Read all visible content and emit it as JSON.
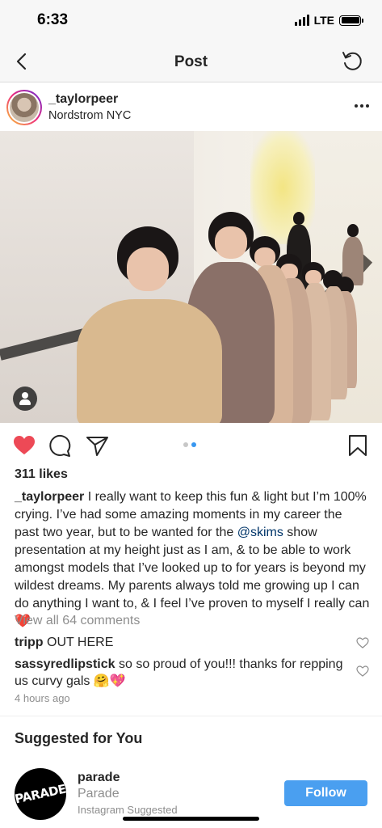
{
  "status_bar": {
    "time": "6:33",
    "network": "LTE",
    "icons": [
      "signal-icon",
      "battery-icon"
    ]
  },
  "nav": {
    "title": "Post",
    "back_icon": "chevron-left-icon",
    "refresh_icon": "refresh-icon"
  },
  "post": {
    "username": "_taylorpeer",
    "location": "Nordstrom NYC",
    "more_icon": "more-options-icon",
    "image_badge_icon": "user-tag-icon",
    "carousel": {
      "count": 2,
      "active_index": 1
    },
    "liked": true,
    "likes": "311 likes",
    "caption": {
      "username": "_taylorpeer",
      "text_before_mention": " I really want to keep this fun & light but I’m 100% crying. I’ve had some amazing moments in my career the past two year, but to be wanted for the ",
      "mention": "@skims",
      "text_after_mention": " show presentation at my height just as I am, & to be able to work amongst models that I’ve looked up to for years is beyond my wildest dreams. My parents always told me growing up I can do anything I want to, & I feel I’ve proven to myself I really can ",
      "emoji": "❤️"
    },
    "view_comments": "View all 64 comments",
    "comments": [
      {
        "username": "tripp",
        "text": " OUT HERE"
      },
      {
        "username": "sassyredlipstick",
        "text": " so so proud of you!!! thanks for repping us curvy gals 🤗💖"
      }
    ],
    "timestamp": "4 hours ago"
  },
  "suggested": {
    "title": "Suggested for You",
    "account": {
      "avatar_text": "PARADE",
      "username": "parade",
      "name": "Parade",
      "source": "Instagram Suggested",
      "follow_label": "Follow"
    }
  },
  "colors": {
    "accent": "#4a9ff0",
    "like_red": "#ed4956",
    "mention": "#003569",
    "muted": "#8e8e8e"
  }
}
